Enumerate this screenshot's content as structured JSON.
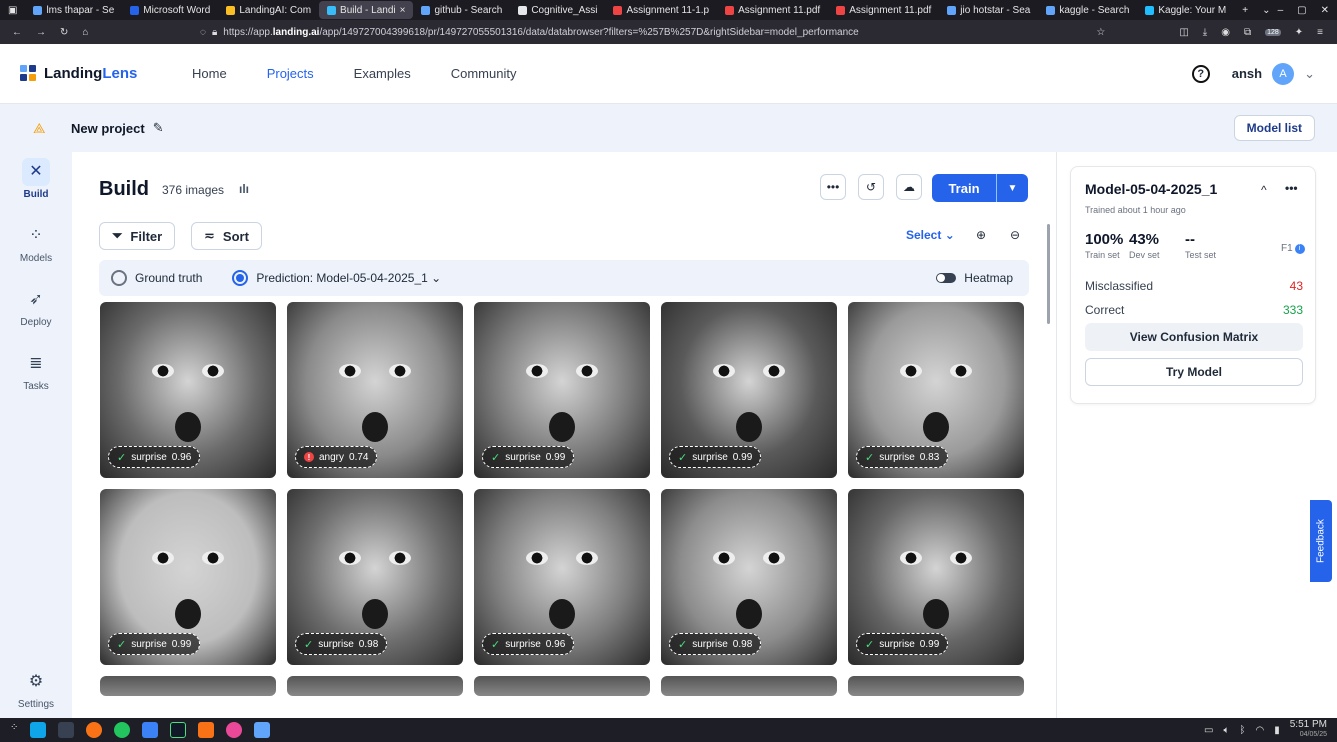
{
  "browser": {
    "tabs": [
      {
        "label": "lms thapar - Se",
        "color": "#60a5fa"
      },
      {
        "label": "Microsoft Word",
        "color": "#2563eb"
      },
      {
        "label": "LandingAI: Com",
        "color": "#fbbf24"
      },
      {
        "label": "Build - Landi",
        "color": "#38bdf8",
        "active": true
      },
      {
        "label": "github - Search",
        "color": "#60a5fa"
      },
      {
        "label": "Cognitive_Assi",
        "color": "#e5e7eb"
      },
      {
        "label": "Assignment 11-1.p",
        "color": "#ef4444"
      },
      {
        "label": "Assignment 11.pdf",
        "color": "#ef4444"
      },
      {
        "label": "Assignment 11.pdf",
        "color": "#ef4444"
      },
      {
        "label": "jio hotstar - Sea",
        "color": "#60a5fa"
      },
      {
        "label": "kaggle - Search",
        "color": "#60a5fa"
      },
      {
        "label": "Kaggle: Your M",
        "color": "#20beff"
      }
    ],
    "url_prefix": "https://app.",
    "url_domain": "landing.ai",
    "url_suffix": "/app/149727004399618/pr/149727055501316/data/databrowser?filters=%257B%257D&rightSidebar=model_performance",
    "ext_badge": "128"
  },
  "header": {
    "logo_text_a": "Landing",
    "logo_text_b": "Lens",
    "nav": [
      "Home",
      "Projects",
      "Examples",
      "Community"
    ],
    "active_nav": "Projects",
    "user": "ansh",
    "avatar_letter": "A"
  },
  "project": {
    "name": "New project",
    "model_list_label": "Model list"
  },
  "sidebar": {
    "items": [
      {
        "label": "Build",
        "icon": "tools-icon"
      },
      {
        "label": "Models",
        "icon": "network-icon"
      },
      {
        "label": "Deploy",
        "icon": "rocket-icon"
      },
      {
        "label": "Tasks",
        "icon": "tasks-icon"
      }
    ],
    "settings_label": "Settings"
  },
  "build": {
    "title": "Build",
    "count": "376 images",
    "train_label": "Train",
    "filter_label": "Filter",
    "sort_label": "Sort",
    "select_label": "Select",
    "ground_truth_label": "Ground truth",
    "prediction_label": "Prediction: Model-05-04-2025_1",
    "heatmap_label": "Heatmap",
    "images": [
      {
        "label": "surprise",
        "score": "0.96",
        "ok": true,
        "tone": "#6b6b6b"
      },
      {
        "label": "angry",
        "score": "0.74",
        "ok": false,
        "tone": "#8a8a8a"
      },
      {
        "label": "surprise",
        "score": "0.99",
        "ok": true,
        "tone": "#7a7a7a"
      },
      {
        "label": "surprise",
        "score": "0.99",
        "ok": true,
        "tone": "#5a5a5a"
      },
      {
        "label": "surprise",
        "score": "0.83",
        "ok": true,
        "tone": "#9a9a9a"
      },
      {
        "label": "surprise",
        "score": "0.99",
        "ok": true,
        "tone": "#bdbdbd"
      },
      {
        "label": "surprise",
        "score": "0.98",
        "ok": true,
        "tone": "#6e6e6e"
      },
      {
        "label": "surprise",
        "score": "0.96",
        "ok": true,
        "tone": "#7d7d7d"
      },
      {
        "label": "surprise",
        "score": "0.98",
        "ok": true,
        "tone": "#8c8c8c"
      },
      {
        "label": "surprise",
        "score": "0.99",
        "ok": true,
        "tone": "#666666"
      }
    ]
  },
  "model": {
    "name": "Model-05-04-2025_1",
    "trained": "Trained about 1 hour ago",
    "train_set_value": "100%",
    "train_set_label": "Train set",
    "dev_set_value": "43%",
    "dev_set_label": "Dev set",
    "test_set_value": "--",
    "test_set_label": "Test set",
    "metric_label": "F1",
    "misclassified_label": "Misclassified",
    "misclassified_value": "43",
    "correct_label": "Correct",
    "correct_value": "333",
    "confusion_label": "View Confusion Matrix",
    "try_label": "Try Model"
  },
  "feedback_label": "Feedback",
  "taskbar": {
    "time": "5:51 PM",
    "date": "04/05/25"
  },
  "colors": {
    "primary": "#2563eb",
    "panel_bg": "#eef3fb",
    "error": "#dc2626",
    "success": "#16a34a"
  }
}
